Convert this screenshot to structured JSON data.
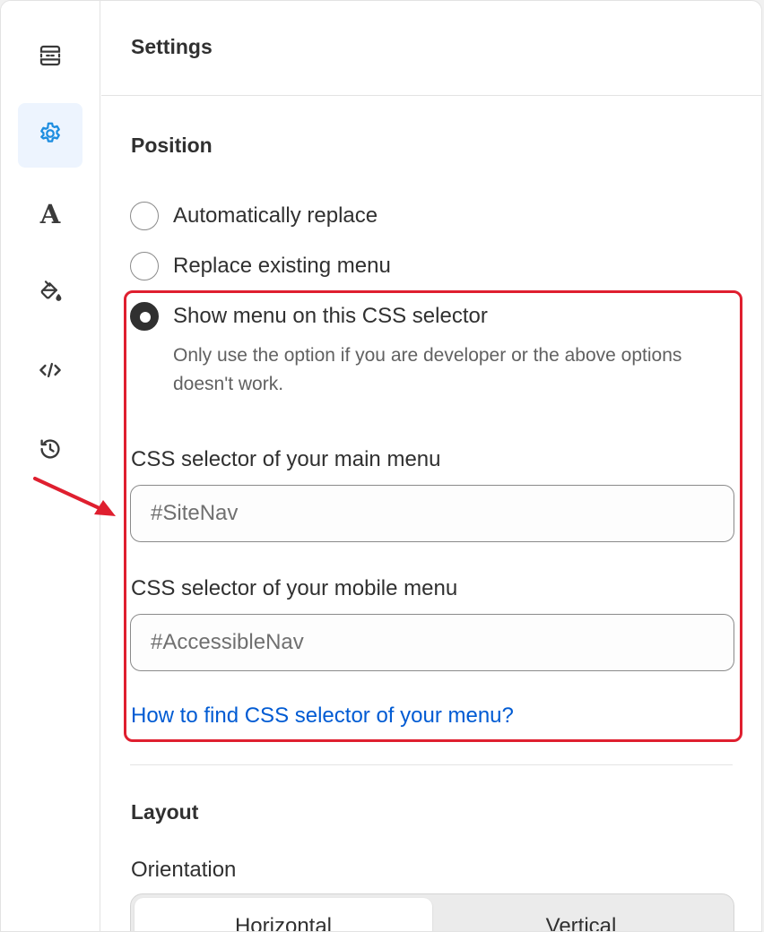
{
  "header": {
    "title": "Settings"
  },
  "position": {
    "title": "Position",
    "options": [
      {
        "label": "Automatically replace",
        "checked": false
      },
      {
        "label": "Replace existing menu",
        "checked": false
      },
      {
        "label": "Show menu on this CSS selector",
        "checked": true
      }
    ],
    "help": "Only use the option if you are developer or the above options doesn't work.",
    "main_menu": {
      "label": "CSS selector of your main menu",
      "placeholder": "#SiteNav"
    },
    "mobile_menu": {
      "label": "CSS selector of your mobile menu",
      "placeholder": "#AccessibleNav"
    },
    "link": "How to find CSS selector of your menu?"
  },
  "layout": {
    "title": "Layout",
    "orientation_label": "Orientation",
    "orientation_options": [
      {
        "label": "Horizontal",
        "active": true
      },
      {
        "label": "Vertical",
        "active": false
      }
    ]
  },
  "sidebar": {
    "items": [
      {
        "icon": "layout-icon",
        "active": false
      },
      {
        "icon": "gear-icon",
        "active": true
      },
      {
        "icon": "typography-icon",
        "glyph": "A",
        "active": false
      },
      {
        "icon": "paint-bucket-icon",
        "active": false
      },
      {
        "icon": "code-icon",
        "active": false
      },
      {
        "icon": "history-icon",
        "active": false
      }
    ]
  },
  "colors": {
    "accent": "#1d8de0",
    "highlight": "#df1f2f",
    "link": "#005bd3"
  }
}
